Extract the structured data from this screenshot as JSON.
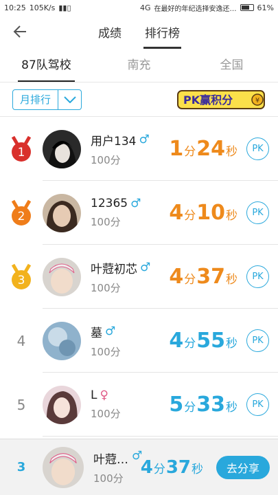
{
  "status_bar": {
    "time": "10:25",
    "speed": "105K/s",
    "network": "4G",
    "notice": "在最好的年纪选择安逸还…",
    "battery": "61%"
  },
  "header": {
    "tabs": [
      "成绩",
      "排行榜"
    ],
    "active_tab": 1
  },
  "subtabs": [
    "87队驾校",
    "南充",
    "全国"
  ],
  "filter": {
    "dropdown_label": "月排行",
    "banner_text": "PK赢积分"
  },
  "accent_colors": {
    "blue": "#29a8dc",
    "orange": "#ee8a1c"
  },
  "rankings": [
    {
      "rank": "1",
      "name": "用户134",
      "gender": "male",
      "score": "100分",
      "min": "1",
      "sec": "24",
      "color": "orange",
      "medal": "#d9302c",
      "pk": "PK"
    },
    {
      "rank": "2",
      "name": "12365",
      "gender": "male",
      "score": "100分",
      "min": "4",
      "sec": "10",
      "color": "orange",
      "medal": "#ef7d1a",
      "pk": "PK"
    },
    {
      "rank": "3",
      "name": "叶蒄初芯",
      "gender": "male",
      "score": "100分",
      "min": "4",
      "sec": "37",
      "color": "orange",
      "medal": "#f2b21d",
      "pk": "PK"
    },
    {
      "rank": "4",
      "name": "墓",
      "gender": "male",
      "score": "100分",
      "min": "4",
      "sec": "55",
      "color": "blue",
      "pk": "PK"
    },
    {
      "rank": "5",
      "name": "L",
      "gender": "female",
      "score": "100分",
      "min": "5",
      "sec": "33",
      "color": "blue",
      "pk": "PK"
    }
  ],
  "my_rank": {
    "rank": "3",
    "name": "叶蒄初芯",
    "gender": "male",
    "score": "100分",
    "min": "4",
    "sec": "37",
    "share_label": "去分享"
  },
  "units": {
    "minute": "分",
    "second": "秒"
  },
  "gender_symbols": {
    "male": "♂",
    "female": "♀"
  }
}
